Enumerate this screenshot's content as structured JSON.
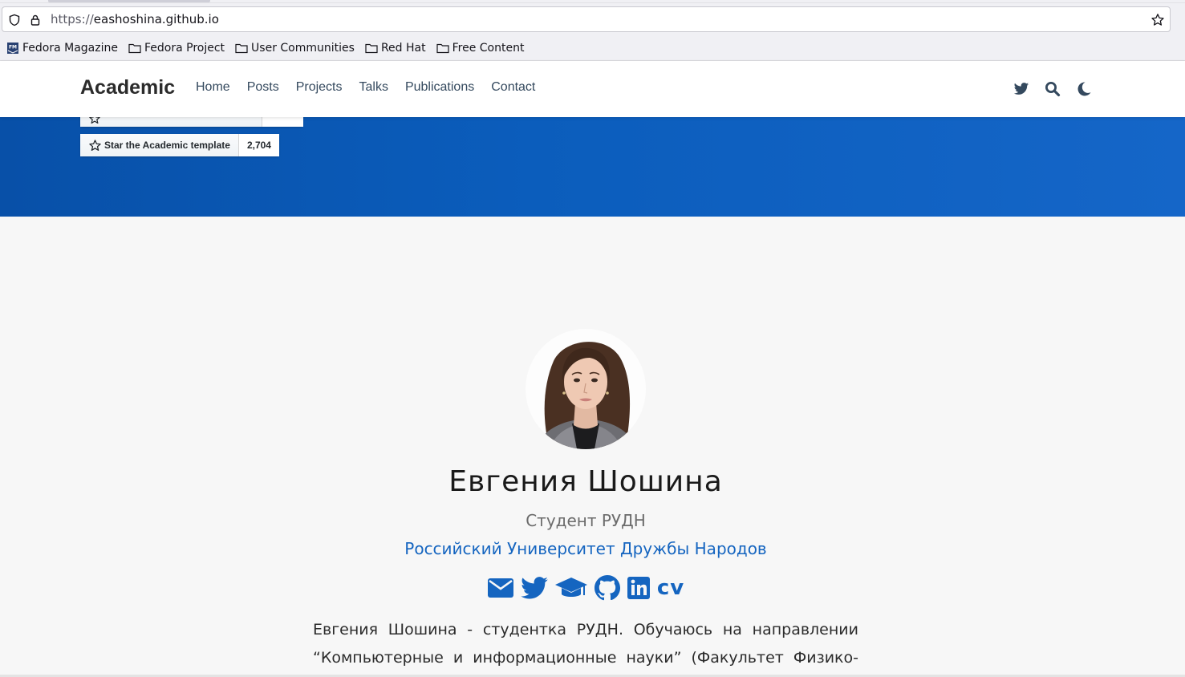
{
  "browser": {
    "url_scheme": "https://",
    "url_host": "eashoshina.github.io",
    "bookmarks": [
      {
        "label": "Fedora Magazine",
        "icon": "fedora-magazine-favicon"
      },
      {
        "label": "Fedora Project",
        "icon": "folder-icon"
      },
      {
        "label": "User Communities",
        "icon": "folder-icon"
      },
      {
        "label": "Red Hat",
        "icon": "folder-icon"
      },
      {
        "label": "Free Content",
        "icon": "folder-icon"
      }
    ]
  },
  "navbar": {
    "brand": "Academic",
    "links": [
      "Home",
      "Posts",
      "Projects",
      "Talks",
      "Publications",
      "Contact"
    ],
    "icons": [
      "twitter-icon",
      "search-icon",
      "moon-icon"
    ]
  },
  "hero": {
    "star_button_label": "Star the Academic template",
    "star_count": "2,704"
  },
  "profile": {
    "name": "Евгения Шошина",
    "role": "Студент РУДН",
    "organization": "Российский Университет Дружбы Народов",
    "social_icons": [
      "envelope-icon",
      "twitter-icon",
      "graduation-cap-icon",
      "github-icon",
      "linkedin-icon",
      "cv-icon"
    ],
    "cv_label": "cv",
    "bio_line1": "Евгения Шошина - студентка РУДН. Обучаюсь на направлении",
    "bio_line2": "“Компьютерные и информационные науки” (Факультет Физико-"
  },
  "colors": {
    "accent": "#1565c0",
    "hero_start": "#0850a8",
    "hero_end": "#1566c8",
    "nav_text": "#34495e"
  }
}
